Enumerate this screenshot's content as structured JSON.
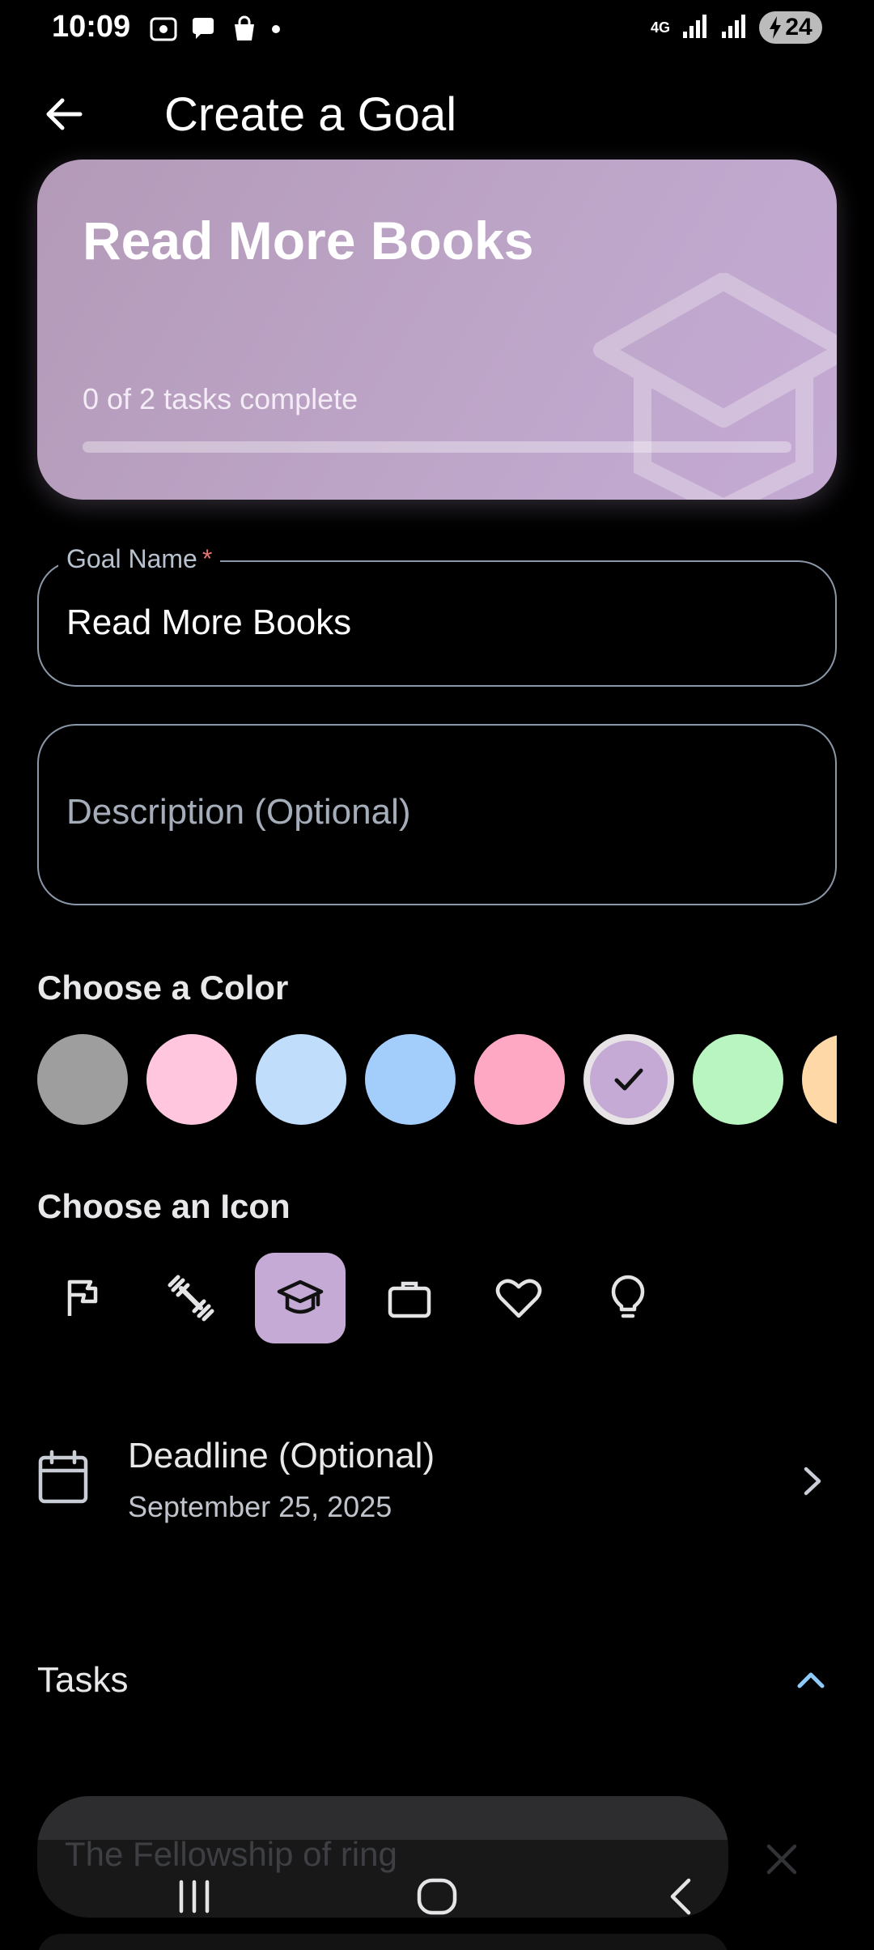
{
  "status_bar": {
    "time": "10:09",
    "network": "4G",
    "battery": "24"
  },
  "app_bar": {
    "title": "Create a Goal",
    "back_icon": "arrow-back-icon"
  },
  "preview": {
    "title": "Read More Books",
    "progress_text": "0 of 2 tasks complete",
    "progress_fraction": 0,
    "watermark_icon": "graduation-cap-icon"
  },
  "form": {
    "goal_name_label": "Goal Name",
    "goal_name_required": "*",
    "goal_name_value": "Read More Books",
    "description_placeholder": "Description (Optional)",
    "description_value": ""
  },
  "colors": {
    "heading": "Choose a Color",
    "swatches": [
      "#9e9e9e",
      "#ffc6de",
      "#c0defc",
      "#a3cdfa",
      "#ffa8c4",
      "#c4aad4",
      "#b8f5c0",
      "#ffd8a8"
    ],
    "selected_index": 5
  },
  "icons": {
    "heading": "Choose an Icon",
    "items": [
      "flag-icon",
      "dumbbell-icon",
      "graduation-cap-icon",
      "briefcase-icon",
      "heart-icon",
      "lightbulb-icon"
    ],
    "selected_index": 2,
    "selected_bg": "#c4aad4"
  },
  "deadline": {
    "label": "Deadline (Optional)",
    "value": "September 25, 2025"
  },
  "tasks": {
    "heading": "Tasks",
    "items": [
      "The Fellowship of ring"
    ]
  },
  "theme": {
    "accent": "#90caf9"
  }
}
